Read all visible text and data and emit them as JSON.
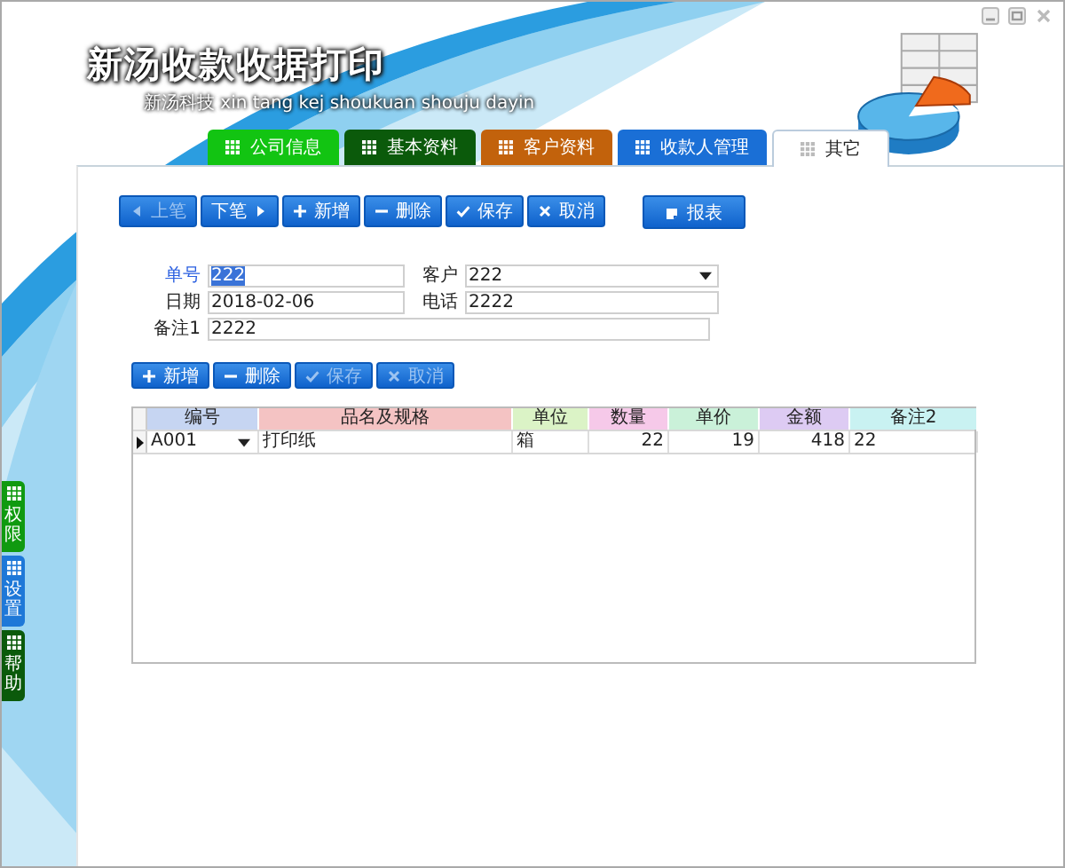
{
  "header": {
    "title": "新汤收款收据打印",
    "subtitle": "新汤科技 xin tang kej shoukuan shouju dayin"
  },
  "tabs": [
    {
      "label": "公司信息",
      "color": "#12c412",
      "selected": false
    },
    {
      "label": "基本资料",
      "color": "#0b5a0b",
      "selected": false
    },
    {
      "label": "客户资料",
      "color": "#c2620c",
      "selected": false
    },
    {
      "label": "收款人管理",
      "color": "#1a6fd6",
      "selected": false
    },
    {
      "label": "其它",
      "selected": true
    }
  ],
  "side_tabs": [
    {
      "label": "权限",
      "color": "#109a10"
    },
    {
      "label": "设置",
      "color": "#1e78d8"
    },
    {
      "label": "帮助",
      "color": "#0b5a0b"
    }
  ],
  "toolbar": [
    {
      "label": "上笔",
      "kind": "prev",
      "disabled": true
    },
    {
      "label": "下笔",
      "kind": "next",
      "disabled": false
    },
    {
      "label": "新增",
      "kind": "add",
      "disabled": false
    },
    {
      "label": "删除",
      "kind": "remove",
      "disabled": false
    },
    {
      "label": "保存",
      "kind": "save",
      "disabled": false
    },
    {
      "label": "取消",
      "kind": "cancel",
      "disabled": false
    }
  ],
  "report_button": {
    "label": "报表"
  },
  "form": {
    "rows": [
      [
        {
          "label": "单号",
          "value": "222",
          "kind": "text",
          "focused": true
        },
        {
          "label": "客户",
          "value": "222",
          "kind": "dropdown",
          "focused": false
        }
      ],
      [
        {
          "label": "日期",
          "value": "2018-02-06",
          "kind": "text",
          "focused": false
        },
        {
          "label": "电话",
          "value": "2222",
          "kind": "text",
          "focused": false
        }
      ],
      [
        {
          "label": "备注1",
          "value": "2222",
          "kind": "text",
          "focused": false
        }
      ]
    ]
  },
  "grid_toolbar": [
    {
      "label": "新增",
      "kind": "add",
      "disabled": false
    },
    {
      "label": "删除",
      "kind": "remove",
      "disabled": false
    },
    {
      "label": "保存",
      "kind": "save",
      "disabled": true
    },
    {
      "label": "取消",
      "kind": "cancel",
      "disabled": true
    }
  ],
  "table": {
    "columns": [
      {
        "label": "编号",
        "color": "#c6d5f2",
        "kind": "dropdown"
      },
      {
        "label": "品名及规格",
        "color": "#f4c3c3",
        "kind": "text"
      },
      {
        "label": "单位",
        "color": "#dbf3c6",
        "kind": "text"
      },
      {
        "label": "数量",
        "color": "#f6c9e9",
        "kind": "number"
      },
      {
        "label": "单价",
        "color": "#caf1d9",
        "kind": "number"
      },
      {
        "label": "金额",
        "color": "#ddcbf3",
        "kind": "number"
      },
      {
        "label": "备注2",
        "color": "#c9f2f2",
        "kind": "text"
      }
    ],
    "rows": [
      {
        "current": true,
        "cells": [
          "A001",
          "打印纸",
          "箱",
          "22",
          "19",
          "418",
          "22"
        ]
      }
    ]
  }
}
